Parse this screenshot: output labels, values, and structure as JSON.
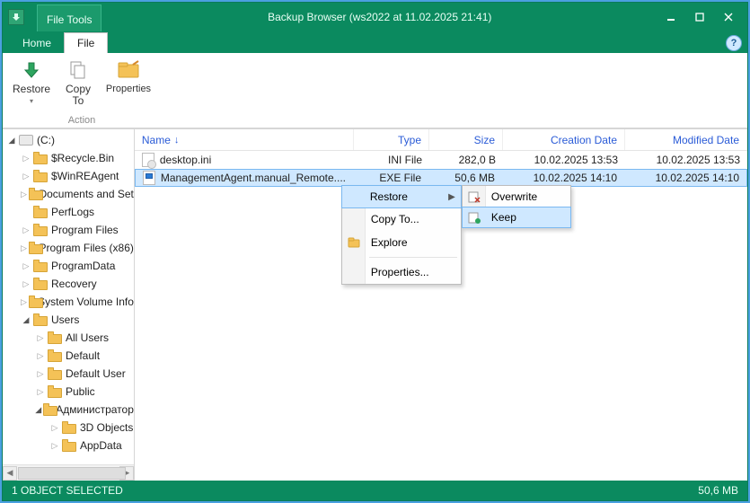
{
  "titlebar": {
    "filetools_label": "File Tools",
    "title": "Backup Browser (ws2022 at 11.02.2025 21:41)"
  },
  "tabs": {
    "home": "Home",
    "file": "File"
  },
  "ribbon": {
    "restore": "Restore",
    "copyto_line1": "Copy",
    "copyto_line2": "To",
    "properties": "Properties",
    "group": "Action"
  },
  "tree": [
    {
      "depth": 0,
      "arrow": "open",
      "icon": "disk",
      "label": "(C:)"
    },
    {
      "depth": 1,
      "arrow": "closed",
      "icon": "folder",
      "label": "$Recycle.Bin"
    },
    {
      "depth": 1,
      "arrow": "closed",
      "icon": "folder",
      "label": "$WinREAgent"
    },
    {
      "depth": 1,
      "arrow": "closed",
      "icon": "folder",
      "label": "Documents and Set"
    },
    {
      "depth": 1,
      "arrow": "none",
      "icon": "folder",
      "label": "PerfLogs"
    },
    {
      "depth": 1,
      "arrow": "closed",
      "icon": "folder",
      "label": "Program Files"
    },
    {
      "depth": 1,
      "arrow": "closed",
      "icon": "folder",
      "label": "Program Files (x86)"
    },
    {
      "depth": 1,
      "arrow": "closed",
      "icon": "folder",
      "label": "ProgramData"
    },
    {
      "depth": 1,
      "arrow": "closed",
      "icon": "folder",
      "label": "Recovery"
    },
    {
      "depth": 1,
      "arrow": "closed",
      "icon": "folder",
      "label": "System Volume Info"
    },
    {
      "depth": 1,
      "arrow": "open",
      "icon": "folder",
      "label": "Users"
    },
    {
      "depth": 2,
      "arrow": "closed",
      "icon": "folder",
      "label": "All Users"
    },
    {
      "depth": 2,
      "arrow": "closed",
      "icon": "folder",
      "label": "Default"
    },
    {
      "depth": 2,
      "arrow": "closed",
      "icon": "folder",
      "label": "Default User"
    },
    {
      "depth": 2,
      "arrow": "closed",
      "icon": "folder",
      "label": "Public"
    },
    {
      "depth": 2,
      "arrow": "open",
      "icon": "folder",
      "label": "Администратор"
    },
    {
      "depth": 3,
      "arrow": "closed",
      "icon": "folder",
      "label": "3D Objects"
    },
    {
      "depth": 3,
      "arrow": "closed",
      "icon": "folder",
      "label": "AppData"
    }
  ],
  "list": {
    "columns": {
      "name": "Name",
      "type": "Type",
      "size": "Size",
      "cdate": "Creation Date",
      "mdate": "Modified Date"
    },
    "rows": [
      {
        "icon": "ini",
        "name": "desktop.ini",
        "type": "INI File",
        "size": "282,0 B",
        "cdate": "10.02.2025 13:53",
        "mdate": "10.02.2025 13:53",
        "selected": false
      },
      {
        "icon": "exe",
        "name": "ManagementAgent.manual_Remote....",
        "type": "EXE File",
        "size": "50,6 MB",
        "cdate": "10.02.2025 14:10",
        "mdate": "10.02.2025 14:10",
        "selected": true
      }
    ]
  },
  "context_menu": {
    "restore": "Restore",
    "copyto": "Copy To...",
    "explore": "Explore",
    "properties": "Properties...",
    "sub_overwrite": "Overwrite",
    "sub_keep": "Keep"
  },
  "statusbar": {
    "left": "1 OBJECT SELECTED",
    "right": "50,6 MB"
  }
}
